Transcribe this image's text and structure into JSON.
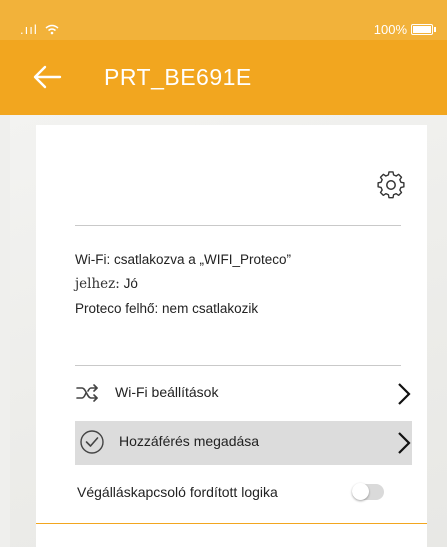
{
  "status_bar": {
    "signal": ".ııl",
    "battery_text": "100%"
  },
  "app_bar": {
    "title": "PRT_BE691E"
  },
  "info": {
    "wifi": "Wi-Fi: csatlakozva a „WIFI_Proteco”",
    "signal_label": "jelhez:",
    "signal_value": "Jó",
    "cloud": "Proteco felhő: nem csatlakozik"
  },
  "menu": {
    "wifi_settings": "Wi-Fi beállítások",
    "grant_access": "Hozzáférés megadása"
  },
  "toggle": {
    "label": "Végálláskapcsoló fordított logika",
    "on": false
  },
  "colors": {
    "accent": "#f2a61f",
    "status_bar": "#f2b23a"
  }
}
